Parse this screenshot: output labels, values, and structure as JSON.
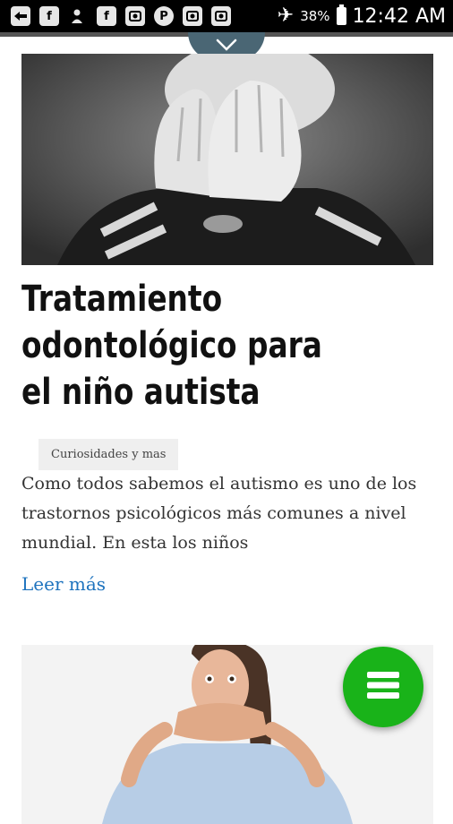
{
  "status_bar": {
    "notification_icons": [
      "share-icon",
      "facebook-icon",
      "user-add-icon",
      "facebook-icon",
      "camera-icon",
      "pinterest-icon",
      "camera-icon",
      "camera-icon"
    ],
    "airplane_icon": "airplane-icon",
    "battery": "38%",
    "time": "12:42 AM"
  },
  "pull_tab": {
    "icon": "chevron-down-icon"
  },
  "article1": {
    "image_icon": "child-covering-eyes-photo",
    "title": "Tratamiento odontológico para el niño autista",
    "category": "Curiosidades y mas",
    "excerpt": "Como todos sabemos el autismo es uno de los trastornos psicológicos más comunes a nivel mundial. En esta los niños",
    "read_more": "Leer más"
  },
  "article2": {
    "image_icon": "woman-covering-mouth-photo"
  },
  "fab": {
    "icon": "menu-icon",
    "color": "#19b319"
  },
  "colors": {
    "link": "#1e73be",
    "tab": "#4a6674"
  }
}
